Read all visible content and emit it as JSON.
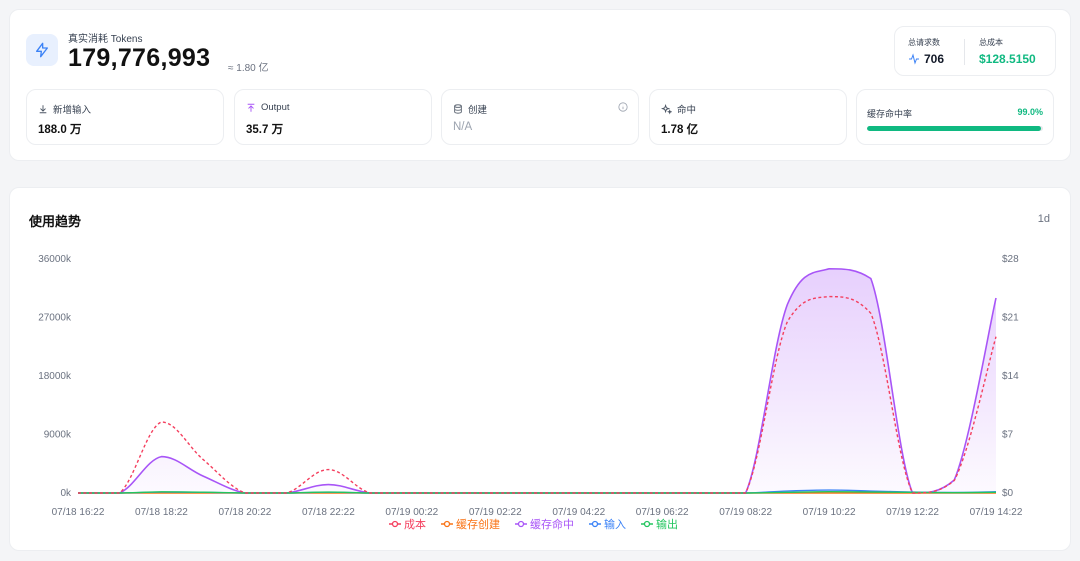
{
  "header": {
    "label": "真实消耗 Tokens",
    "value": "179,776,993",
    "approx": "≈ 1.80 亿",
    "icon": "bolt-icon",
    "accent": "#3b82f6"
  },
  "summary": {
    "requests_label": "总请求数",
    "requests_value": "706",
    "cost_label": "总成本",
    "cost_value": "$128.5150",
    "cost_color": "#10b981"
  },
  "metrics": [
    {
      "label": "新增输入",
      "value": "188.0 万",
      "icon": "download-icon"
    },
    {
      "label": "Output",
      "value": "35.7 万",
      "icon": "upload-icon"
    },
    {
      "label": "创建",
      "value": "N/A",
      "icon": "database-icon"
    },
    {
      "label": "命中",
      "value": "1.78 亿",
      "icon": "sparkle-icon"
    }
  ],
  "cache_hit": {
    "label": "缓存命中率",
    "value": "99.0%",
    "fraction": 0.99
  },
  "chart": {
    "title": "使用趋势",
    "range": "1d"
  },
  "chart_data": {
    "type": "line",
    "x": [
      "07/18 16:22",
      "07/18 17:22",
      "07/18 18:22",
      "07/18 19:22",
      "07/18 20:22",
      "07/18 21:22",
      "07/18 22:22",
      "07/18 23:22",
      "07/19 00:22",
      "07/19 01:22",
      "07/19 02:22",
      "07/19 03:22",
      "07/19 04:22",
      "07/19 05:22",
      "07/19 06:22",
      "07/19 07:22",
      "07/19 08:22",
      "07/19 09:22",
      "07/19 10:22",
      "07/19 11:22",
      "07/19 12:22",
      "07/19 13:22",
      "07/19 14:22"
    ],
    "x_ticks": [
      "07/18 16:22",
      "07/18 18:22",
      "07/18 20:22",
      "07/18 22:22",
      "07/19 00:22",
      "07/19 02:22",
      "07/19 04:22",
      "07/19 06:22",
      "07/19 08:22",
      "07/19 10:22",
      "07/19 12:22",
      "07/19 14:22"
    ],
    "y_left": {
      "ticks": [
        "0k",
        "9000k",
        "18000k",
        "27000k",
        "36000k"
      ],
      "lim": [
        0,
        36000
      ]
    },
    "y_right": {
      "ticks": [
        "$0",
        "$7",
        "$14",
        "$21",
        "$28"
      ],
      "lim": [
        0,
        28
      ]
    },
    "series": [
      {
        "name": "成本",
        "axis": "right",
        "color": "#f43f5e",
        "dashed": true,
        "values": [
          0,
          0,
          8.5,
          4,
          0,
          0,
          2.8,
          0,
          0,
          0,
          0,
          0,
          0,
          0,
          0,
          0,
          0,
          20.5,
          23.5,
          21.5,
          0,
          1.5,
          18.7
        ]
      },
      {
        "name": "缓存创建",
        "axis": "left",
        "color": "#f97316",
        "values": [
          0,
          0,
          0,
          0,
          0,
          0,
          0,
          0,
          0,
          0,
          0,
          0,
          0,
          0,
          0,
          0,
          0,
          0,
          0,
          0,
          0,
          0,
          0
        ]
      },
      {
        "name": "缓存命中",
        "axis": "left",
        "color": "#a855f7",
        "fill": true,
        "values": [
          0,
          0,
          5600,
          2600,
          0,
          0,
          1300,
          0,
          0,
          0,
          0,
          0,
          0,
          0,
          0,
          0,
          0,
          29000,
          34500,
          33000,
          0,
          2000,
          30000
        ]
      },
      {
        "name": "输入",
        "axis": "left",
        "color": "#3b82f6",
        "values": [
          0,
          0,
          150,
          100,
          0,
          0,
          120,
          0,
          0,
          0,
          0,
          0,
          0,
          0,
          0,
          0,
          0,
          300,
          450,
          300,
          150,
          80,
          200
        ]
      },
      {
        "name": "输出",
        "axis": "left",
        "color": "#22c55e",
        "values": [
          0,
          0,
          180,
          120,
          0,
          0,
          150,
          0,
          0,
          0,
          0,
          0,
          0,
          0,
          0,
          0,
          0,
          100,
          200,
          150,
          100,
          50,
          100
        ]
      }
    ]
  }
}
